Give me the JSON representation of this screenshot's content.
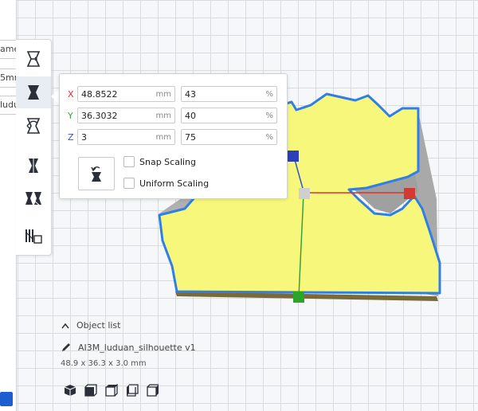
{
  "left_edge": {
    "stub_1": "ame",
    "stub_2": "5mm",
    "stub_3": "luduan"
  },
  "tools": [
    {
      "name": "move-tool",
      "icon": "move-icon"
    },
    {
      "name": "scale-tool",
      "icon": "scale-icon",
      "active": true
    },
    {
      "name": "rotate-tool",
      "icon": "rotate-icon"
    },
    {
      "name": "mirror-tool",
      "icon": "mirror-icon"
    },
    {
      "name": "per-model-settings-tool",
      "icon": "per-model-settings-icon"
    },
    {
      "name": "support-blocker-tool",
      "icon": "support-blocker-icon"
    }
  ],
  "scale_panel": {
    "x": {
      "label": "X",
      "mm": "48.8522",
      "pct": "43",
      "color": "#e0302b"
    },
    "y": {
      "label": "Y",
      "mm": "36.3032",
      "pct": "40",
      "color": "#3ca03c"
    },
    "z": {
      "label": "Z",
      "mm": "3",
      "pct": "75",
      "color": "#3355cc"
    },
    "unit_mm": "mm",
    "unit_pct": "%",
    "snap_scaling": "Snap Scaling",
    "uniform_scaling": "Uniform Scaling"
  },
  "object_list": {
    "header": "Object list",
    "name": "AI3M_luduan_silhouette v1",
    "dimensions": "48.9 x 36.3 x 3.0 mm"
  },
  "view_buttons": [
    "3d-view-icon",
    "front-view-icon",
    "top-view-icon",
    "left-view-icon",
    "right-view-icon"
  ],
  "colors": {
    "model_fill": "#f7f77c",
    "model_outline": "#2f7fe6",
    "model_shadow": "#a8a8a8",
    "accent": "#1c5dd0"
  }
}
